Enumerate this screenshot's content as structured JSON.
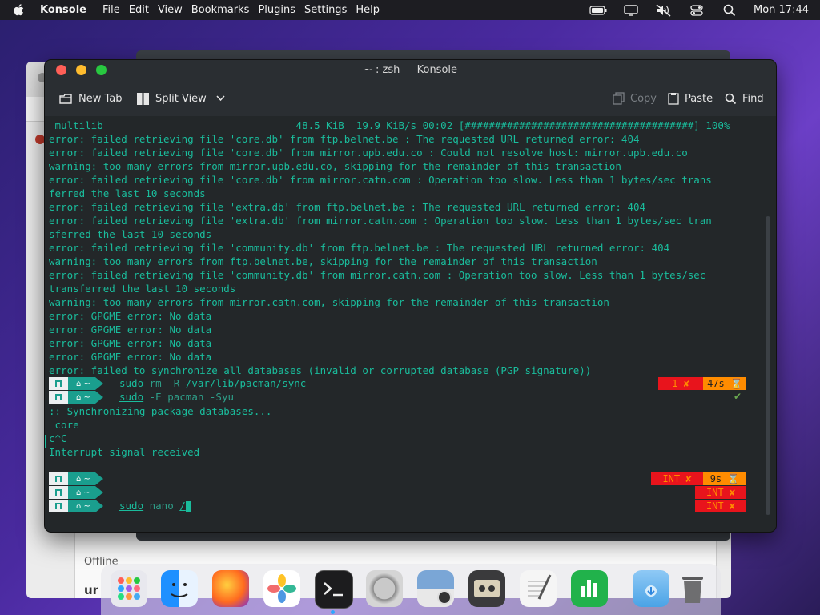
{
  "menubar": {
    "app_name": "Konsole",
    "menus": [
      "File",
      "Edit",
      "View",
      "Bookmarks",
      "Plugins",
      "Settings",
      "Help"
    ],
    "clock": "Mon 17:44",
    "status_icons": [
      "battery-icon",
      "screen-mirror-icon",
      "muted-speaker-icon",
      "control-center-icon",
      "search-icon"
    ]
  },
  "background_window": {
    "status_text": "Offline",
    "heading_fragment": "ur"
  },
  "konsole": {
    "title": "~ : zsh — Konsole",
    "toolbar": {
      "new_tab": "New Tab",
      "split_view": "Split View",
      "copy": "Copy",
      "paste": "Paste",
      "find": "Find"
    },
    "output_lines": [
      " multilib                                48.5 KiB  19.9 KiB/s 00:02 [######################################] 100%",
      "error: failed retrieving file 'core.db' from ftp.belnet.be : The requested URL returned error: 404",
      "error: failed retrieving file 'core.db' from mirror.upb.edu.co : Could not resolve host: mirror.upb.edu.co",
      "warning: too many errors from mirror.upb.edu.co, skipping for the remainder of this transaction",
      "error: failed retrieving file 'core.db' from mirror.catn.com : Operation too slow. Less than 1 bytes/sec trans",
      "ferred the last 10 seconds",
      "error: failed retrieving file 'extra.db' from ftp.belnet.be : The requested URL returned error: 404",
      "error: failed retrieving file 'extra.db' from mirror.catn.com : Operation too slow. Less than 1 bytes/sec tran",
      "sferred the last 10 seconds",
      "error: failed retrieving file 'community.db' from ftp.belnet.be : The requested URL returned error: 404",
      "warning: too many errors from ftp.belnet.be, skipping for the remainder of this transaction",
      "error: failed retrieving file 'community.db' from mirror.catn.com : Operation too slow. Less than 1 bytes/sec",
      "transferred the last 10 seconds",
      "warning: too many errors from mirror.catn.com, skipping for the remainder of this transaction",
      "error: GPGME error: No data",
      "error: GPGME error: No data",
      "error: GPGME error: No data",
      "error: GPGME error: No data",
      "error: failed to synchronize all databases (invalid or corrupted database (PGP signature))"
    ],
    "prompt_home": "~",
    "cmd1": {
      "sudo": "sudo",
      "rest": " rm -R ",
      "path": "/var/lib/pacman/sync"
    },
    "cmd1_status": {
      "code": "1 ✘",
      "time": "47s ⌛"
    },
    "cmd2": {
      "sudo": "sudo",
      "rest": " -E pacman -Syu"
    },
    "cmd2_check": "✔",
    "after_lines": [
      ":: Synchronizing package databases...",
      " core",
      "c^C",
      "Interrupt signal received"
    ],
    "int_status": {
      "code": "INT ✘",
      "time": "9s ⌛"
    },
    "int_status2": "INT ✘",
    "int_status3": "INT ✘",
    "cmd3": {
      "sudo": "sudo",
      "rest": " nano ",
      "path": "/"
    }
  },
  "dock": {
    "items": [
      "launchpad-icon",
      "finder-icon",
      "firefox-icon",
      "photos-icon",
      "terminal-icon",
      "system-settings-icon",
      "preview-icon",
      "tape-icon",
      "text-editor-icon",
      "numbers-icon",
      "downloads-icon",
      "trash-icon"
    ]
  },
  "colors": {
    "terminal_text": "#1abc9c",
    "terminal_bg": "#232729",
    "status_red": "#e8141c",
    "status_orange": "#ff8c00"
  }
}
